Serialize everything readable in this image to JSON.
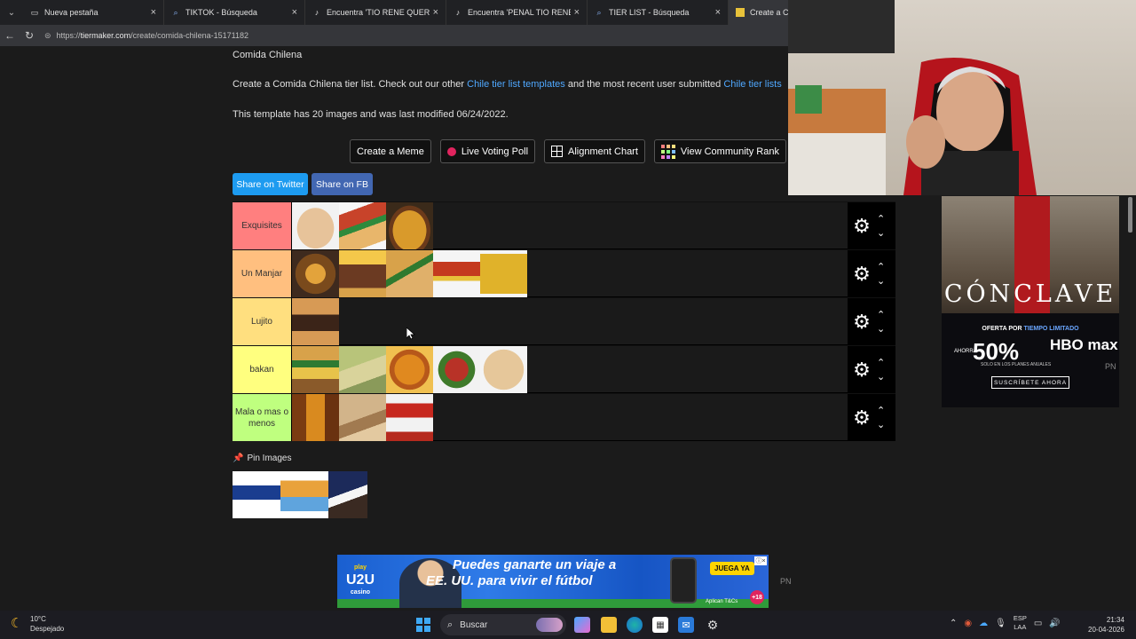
{
  "tabs": [
    {
      "title": "Nueva pestaña",
      "icon": "new-tab-icon"
    },
    {
      "title": "TIKTOK - Búsqueda",
      "icon": "search-icon"
    },
    {
      "title": "Encuentra 'TIO RENE QUERI TO FUCKS' en TikTok",
      "icon": "tiktok-icon"
    },
    {
      "title": "Encuentra 'PENAL TIO RENE' en TikTok",
      "icon": "tiktok-icon"
    },
    {
      "title": "TIER LIST - Búsqueda",
      "icon": "search-icon"
    },
    {
      "title": "Create a Comida Chilena Tier List",
      "icon": "tiermaker-icon"
    }
  ],
  "address": {
    "prefix": "https://",
    "host": "tiermaker.com",
    "path": "/create/comida-chilena-15171182"
  },
  "page": {
    "title": "Comida Chilena",
    "desc_before": "Create a Comida Chilena tier list. Check out our other ",
    "desc_link1": "Chile tier list templates",
    "desc_middle": " and the most recent user submitted ",
    "desc_link2": "Chile tier lists",
    "meta": "This template has 20 images and was last modified 06/24/2022."
  },
  "buttons": {
    "meme": "Create a Meme",
    "poll": "Live Voting Poll",
    "alignment": "Alignment Chart",
    "community": "View Community Rank",
    "twitter": "Share on Twitter",
    "fb": "Share on FB"
  },
  "tiers": [
    {
      "label": "Exquisites",
      "color": "#ff7f7f",
      "items": [
        "bread-roll",
        "hot-dog",
        "pastel-de-choclo"
      ]
    },
    {
      "label": "Un Manjar",
      "color": "#ffbf7f",
      "items": [
        "cazuela",
        "lomo-a-lo-pobre",
        "chacarero",
        "super-8",
        "kryzpo-chips"
      ]
    },
    {
      "label": "Lujito",
      "color": "#ffdf7f",
      "items": [
        "churrasco"
      ]
    },
    {
      "label": "bakan",
      "color": "#ffff7f",
      "items": [
        "completo",
        "humitas",
        "porotos",
        "pebre",
        "sopaipilla"
      ]
    },
    {
      "label": "Mala o mas o menos",
      "color": "#bfff7f",
      "items": [
        "beer",
        "empanada",
        "trencito"
      ]
    }
  ],
  "pin": {
    "label": "Pin Images",
    "items": [
      "chocman",
      "calaf-dessert",
      "negrita"
    ]
  },
  "side_ad": {
    "title": "CÓNCLAVE",
    "offer": "OFERTA POR",
    "offer_em": "TIEMPO LIMITADO",
    "ahorra": "AHORRA",
    "percent": "50%",
    "planes": "SOLO EN LOS PLANES ANUALES",
    "brand": "HBO max",
    "cta": "SUSCRÍBETE AHORA",
    "pn": "PN"
  },
  "bottom_ad": {
    "logo_play": "play",
    "logo": "U2U",
    "logo_sub": "casino",
    "line1": "Puedes ganarte un viaje a",
    "line2": "EE. UU. para vivir el fútbol",
    "cta": "JUEGA YA",
    "age": "+18",
    "tc": "Aplican T&Cs",
    "pn": "PN"
  },
  "taskbar": {
    "temp": "10°C",
    "weather": "Despejado",
    "search": "Buscar",
    "lang1": "ESP",
    "lang2": "LAA",
    "time": "21:34",
    "date": "20-04-2026"
  }
}
